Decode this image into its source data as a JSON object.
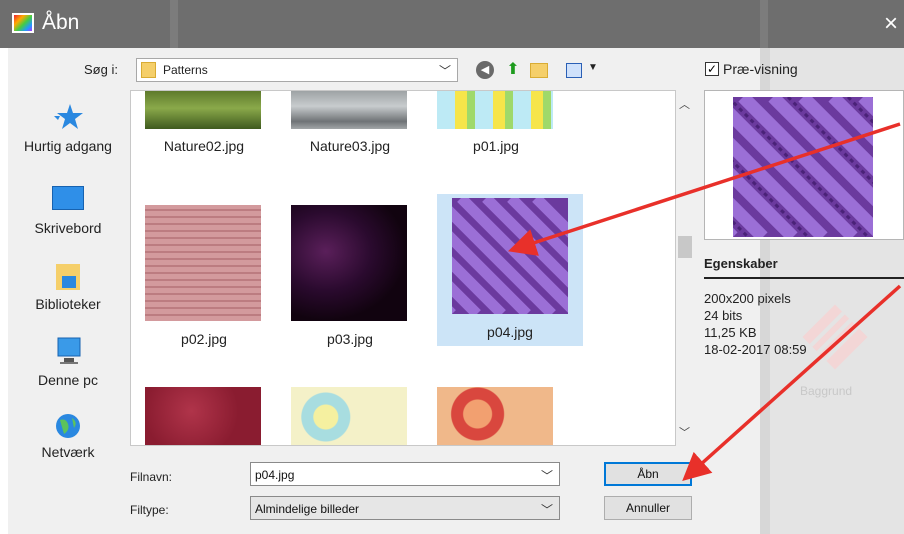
{
  "window": {
    "title": "Åbn",
    "close_glyph": "×"
  },
  "lookin": {
    "label": "Søg i:",
    "value": "Patterns"
  },
  "toolbar": {
    "icons": [
      "back-icon",
      "up-folder-icon",
      "new-folder-icon",
      "view-menu-icon"
    ]
  },
  "places": [
    {
      "label": "Hurtig adgang",
      "icon": "star-icon"
    },
    {
      "label": "Skrivebord",
      "icon": "desktop-icon"
    },
    {
      "label": "Biblioteker",
      "icon": "libraries-icon"
    },
    {
      "label": "Denne pc",
      "icon": "computer-icon"
    },
    {
      "label": "Netværk",
      "icon": "network-icon"
    }
  ],
  "files": [
    {
      "name": "Nature02.jpg"
    },
    {
      "name": "Nature03.jpg"
    },
    {
      "name": "p01.jpg"
    },
    {
      "name": "p02.jpg"
    },
    {
      "name": "p03.jpg"
    },
    {
      "name": "p04.jpg",
      "selected": true
    },
    {
      "name": ""
    },
    {
      "name": ""
    },
    {
      "name": ""
    }
  ],
  "form": {
    "filename_label": "Filnavn:",
    "filename_value": "p04.jpg",
    "filetype_label": "Filtype:",
    "filetype_value": "Almindelige billeder",
    "open_label": "Åbn",
    "cancel_label": "Annuller"
  },
  "preview": {
    "checkbox_label": "Præ-visning",
    "checked": true,
    "properties_title": "Egenskaber",
    "properties": [
      "200x200 pixels",
      "24 bits",
      "11,25 KB",
      "18-02-2017 08:59"
    ]
  },
  "background_text": "Baggrund",
  "colors": {
    "accent": "#0078d7",
    "annotation_arrow": "#e8302a",
    "selection": "#cce4f7"
  }
}
